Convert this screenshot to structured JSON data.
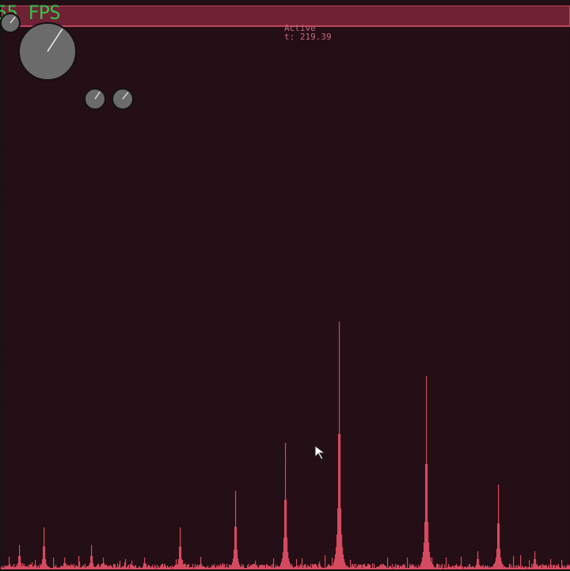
{
  "hud": {
    "fps_label": "55 FPS",
    "status_label": "Active",
    "time_label": "t: 219.39"
  },
  "dials": [
    {
      "name": "dial-small-topleft",
      "level": 0.9
    },
    {
      "name": "dial-main",
      "level": 0.88
    },
    {
      "name": "dial-aux-1",
      "level": 0.88
    },
    {
      "name": "dial-aux-2",
      "level": 0.9
    }
  ],
  "colors": {
    "background": "#2a1119",
    "bar": "#6e2233",
    "bar_border": "#c0455a",
    "fps": "#35c04c",
    "status_text": "#c46b7c",
    "spectrum": "#d44a5e",
    "dial_face": "#6b6b6b",
    "dial_needle": "#e6e6e6"
  },
  "spectrum": {
    "bins": 720,
    "peaks": [
      {
        "freq": 23,
        "amp": 0.04
      },
      {
        "freq": 54,
        "amp": 0.07
      },
      {
        "freq": 80,
        "amp": 0.02
      },
      {
        "freq": 114,
        "amp": 0.04
      },
      {
        "freq": 129,
        "amp": 0.02
      },
      {
        "freq": 181,
        "amp": 0.02
      },
      {
        "freq": 226,
        "amp": 0.07
      },
      {
        "freq": 296,
        "amp": 0.13
      },
      {
        "freq": 359,
        "amp": 0.21
      },
      {
        "freq": 427,
        "amp": 0.41
      },
      {
        "freq": 537,
        "amp": 0.32
      },
      {
        "freq": 602,
        "amp": 0.03
      },
      {
        "freq": 628,
        "amp": 0.14
      },
      {
        "freq": 674,
        "amp": 0.03
      }
    ]
  },
  "cursor": {
    "icon": "pointer-arrow-icon"
  }
}
